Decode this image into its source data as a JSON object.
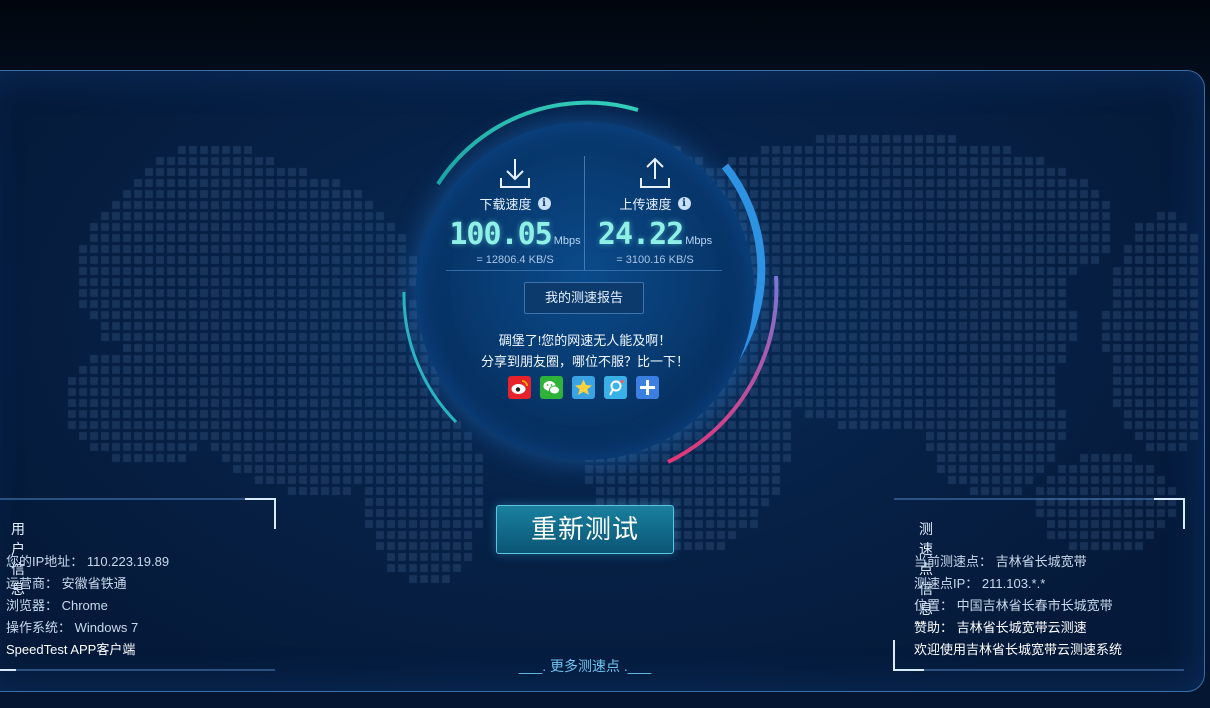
{
  "speedtest": {
    "download": {
      "label": "下载速度",
      "value": "100.05",
      "unit": "Mbps",
      "kbs": "= 12806.4  KB/S"
    },
    "upload": {
      "label": "上传速度",
      "value": "24.22",
      "unit": "Mbps",
      "kbs": "= 3100.16  KB/S"
    },
    "report_button": "我的测速报告",
    "share_line1": "碉堡了!您的网速无人能及啊！",
    "share_line2": "分享到朋友圈，哪位不服？比一下！",
    "share_icons": [
      "weibo-icon",
      "wechat-icon",
      "qzone-icon",
      "tencent-weibo-icon",
      "more-share-icon"
    ]
  },
  "retest_button": "重新测试",
  "more_nodes_link": "___. 更多测速点 .___",
  "user_info": {
    "title": "用户信息",
    "ip": "您的IP地址： 110.223.19.89",
    "isp": "运营商： 安徽省铁通",
    "browser": "浏览器： Chrome",
    "os": "操作系统： Windows 7",
    "app": "SpeedTest APP客户端"
  },
  "node_info": {
    "title": "测速点信息",
    "current": "当前测速点： 吉林省长城宽带",
    "node_ip": "测速点IP： 211.103.*.*",
    "location": "位置： 中国吉林省长春市长城宽带",
    "sponsor": "赞助： 吉林省长城宽带云测速",
    "welcome": "欢迎使用吉林省长城宽带云测速系统"
  },
  "colors": {
    "accent": "#8ff0e8",
    "arc_teal": "#2bc6b0",
    "arc_blue": "#2f8fe0",
    "arc_pink": "#e8357a",
    "panel_border": "#3a6ea4"
  }
}
